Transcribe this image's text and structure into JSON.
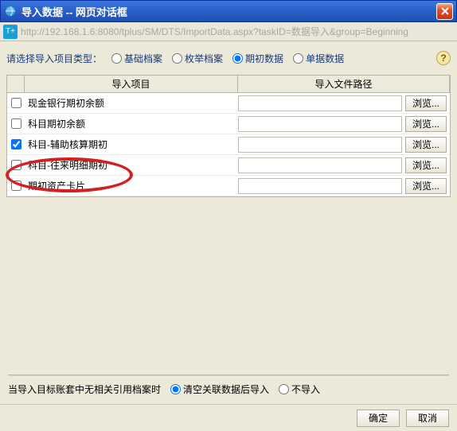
{
  "window": {
    "title": "导入数据 -- 网页对话框"
  },
  "address": {
    "url": "http://192.168.1.6:8080/tplus/SM/DTS/ImportData.aspx?taskID=数据导入&group=Beginning"
  },
  "type_prompt": "请选择导入项目类型：",
  "type_options": {
    "base": "基础档案",
    "enum": "枚举档案",
    "initial": "期初数据",
    "bill": "单据数据"
  },
  "header": {
    "col_item": "导入项目",
    "col_path": "导入文件路径"
  },
  "rows": [
    {
      "checked": false,
      "label": "现金银行期初余额"
    },
    {
      "checked": false,
      "label": "科目期初余额"
    },
    {
      "checked": true,
      "label": "科目-辅助核算期初"
    },
    {
      "checked": false,
      "label": "科目-往来明细期初"
    },
    {
      "checked": false,
      "label": "期初资产卡片"
    }
  ],
  "browse_label": "浏览...",
  "footer": {
    "prompt": "当导入目标账套中无相关引用档案时",
    "opt_clear": "清空关联数据后导入",
    "opt_skip": "不导入"
  },
  "buttons": {
    "ok": "确定",
    "cancel": "取消"
  }
}
